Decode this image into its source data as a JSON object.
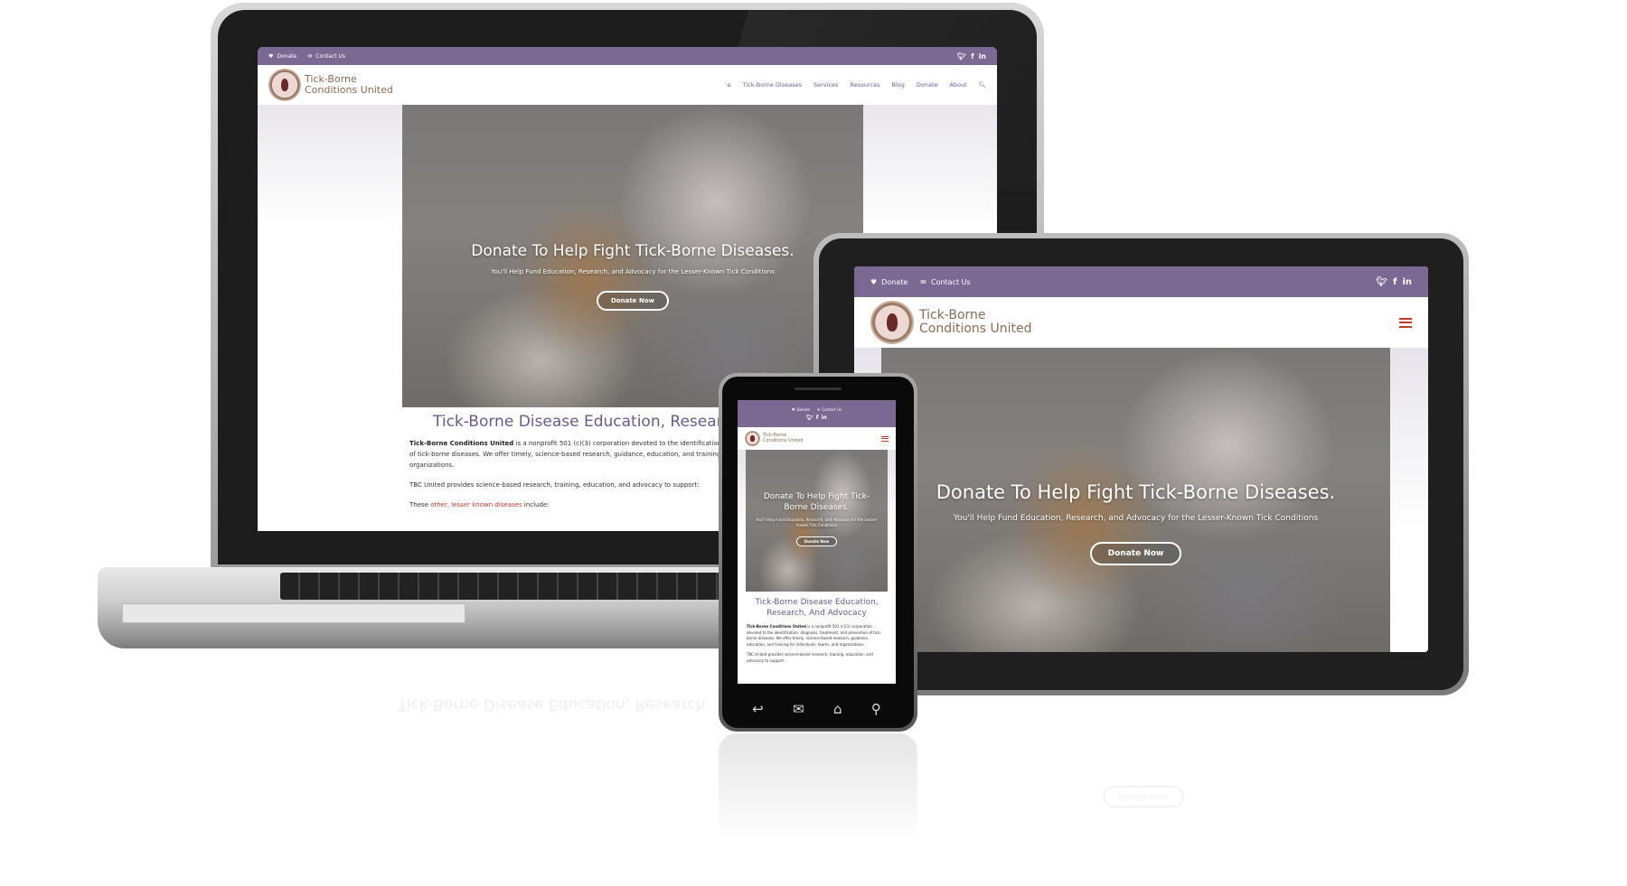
{
  "site": {
    "brand_line1": "Tick-Borne",
    "brand_line2": "Conditions United",
    "topbar": {
      "donate": "Donate",
      "contact": "Contact Us",
      "social": [
        "twitter",
        "facebook",
        "linkedin"
      ],
      "social_glyphs": {
        "twitter": "🐦︎",
        "facebook": "f",
        "linkedin": "in"
      }
    },
    "nav": {
      "home_icon": "home-icon",
      "items": [
        "Tick-Borne Diseases",
        "Services",
        "Resources",
        "Blog",
        "Donate",
        "About"
      ],
      "search_icon": "search-icon"
    },
    "hero": {
      "title": "Donate To Help Fight Tick-Borne Diseases.",
      "subtitle": "You'll Help Fund Education, Research, and Advocacy for the Lesser-Known Tick Conditions",
      "button": "Donate Now"
    },
    "content": {
      "heading": "Tick-Borne Disease Education, Research, And Advocacy",
      "heading_laptop_visible": "Tick-Borne Disease Education, Research",
      "p1_bold": "Tick-Borne Conditions United",
      "p1_rest": " is a nonprofit 501 (c)(3) corporation devoted to the identification, diagnosis, treatment, and prevention of tick-borne diseases. We offer timely, science-based research, guidance, education, and training for individuals, teams, and organizations.",
      "p2": "TBC United provides science-based research, training, education, and advocacy to support:",
      "p3_pre": "These ",
      "p3_link": "other, lesser known diseases",
      "p3_post": " include:"
    }
  },
  "colors": {
    "topbar": "#7b6893",
    "heading": "#6b5a8e",
    "accent_red": "#c0392b",
    "logo_brown": "#8a6a55"
  },
  "phone_nav_icons": [
    "back-icon",
    "mail-icon",
    "home-icon",
    "search-icon"
  ]
}
